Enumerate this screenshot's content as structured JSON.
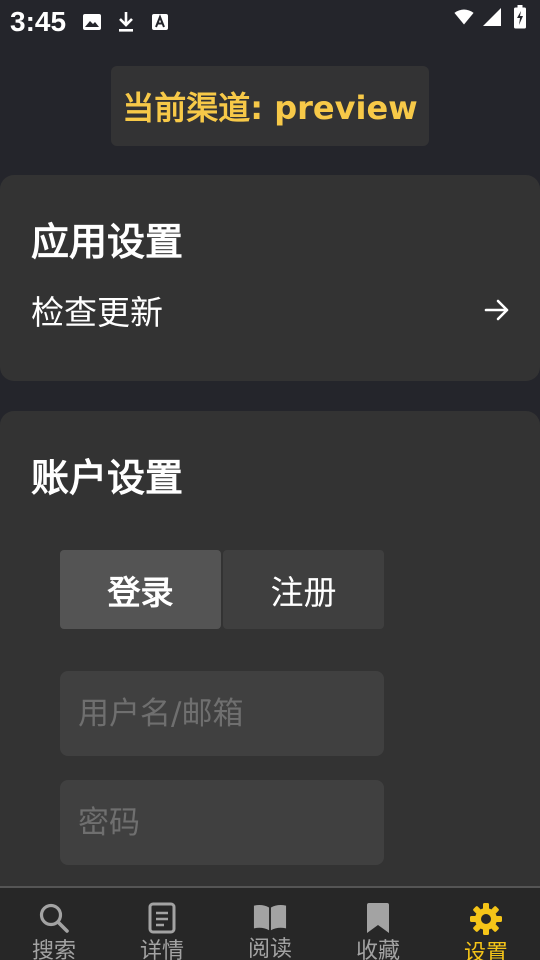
{
  "status_bar": {
    "time": "3:45",
    "left_icons": [
      "image-icon",
      "download-icon",
      "font-icon"
    ],
    "right_icons": [
      "wifi-icon",
      "signal-icon",
      "battery-charging-icon"
    ]
  },
  "channel": {
    "label": "当前渠道: preview"
  },
  "app_settings": {
    "title": "应用设置",
    "check_update_label": "检查更新",
    "check_update_icon": "arrow-right-icon"
  },
  "account_settings": {
    "title": "账户设置",
    "tabs": [
      {
        "label": "登录",
        "active": true
      },
      {
        "label": "注册",
        "active": false
      }
    ],
    "username_placeholder": "用户名/邮箱",
    "username_value": "",
    "password_placeholder": "密码",
    "password_value": ""
  },
  "bottom_nav": {
    "items": [
      {
        "label": "搜索",
        "icon": "search-icon",
        "active": false
      },
      {
        "label": "详情",
        "icon": "document-icon",
        "active": false
      },
      {
        "label": "阅读",
        "icon": "book-icon",
        "active": false
      },
      {
        "label": "收藏",
        "icon": "bookmark-icon",
        "active": false
      },
      {
        "label": "设置",
        "icon": "gear-icon",
        "active": true
      }
    ]
  },
  "colors": {
    "background": "#24252b",
    "card": "#333333",
    "accent": "#f5c518",
    "channel_text": "#f7c948",
    "nav_inactive": "#a3a3a3"
  }
}
